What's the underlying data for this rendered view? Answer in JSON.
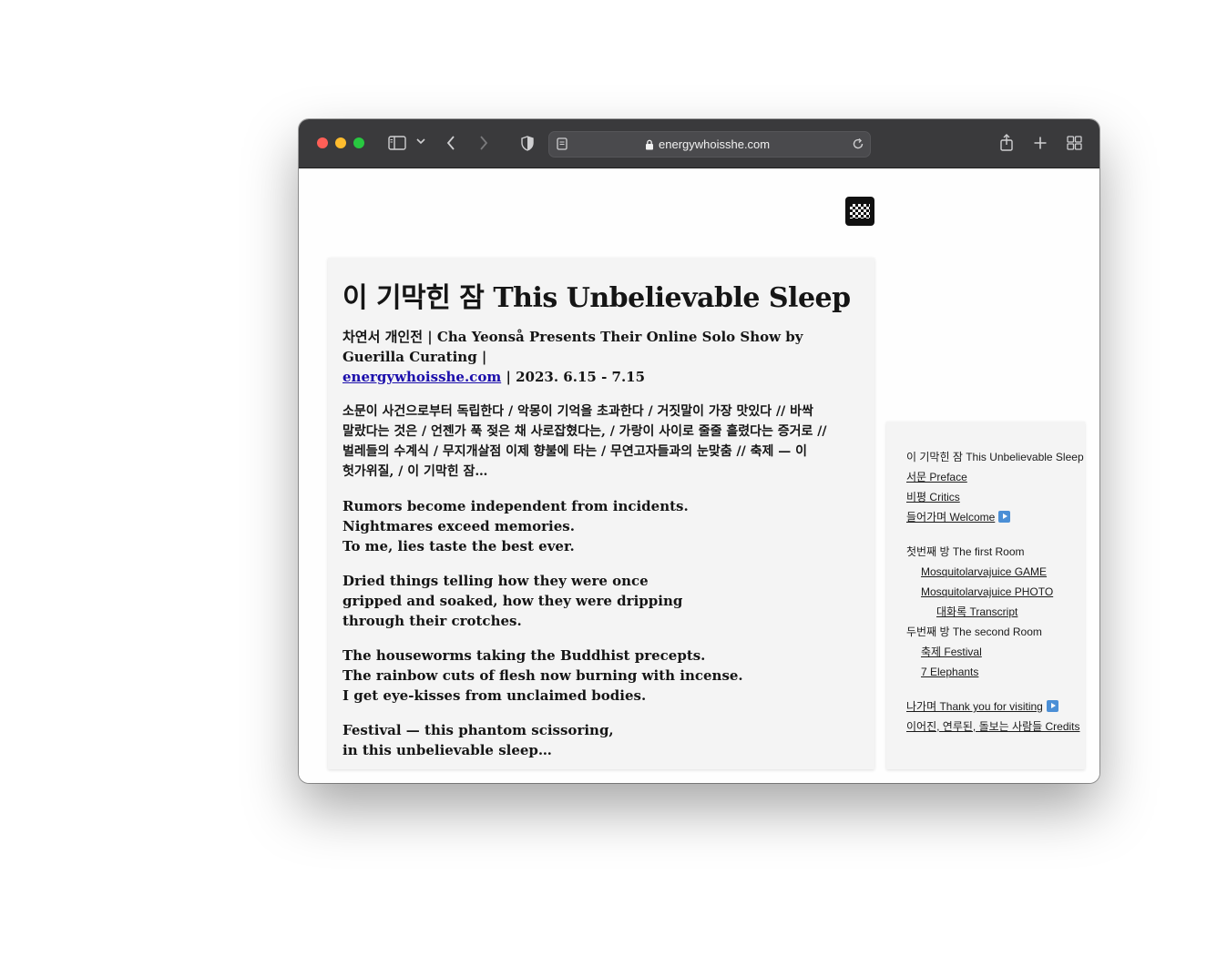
{
  "browser": {
    "url": "energywhoisshe.com"
  },
  "article": {
    "title": "이 기막힌 잠 This Unbelievable Sleep",
    "subtitle_prefix": "차연서 개인전 | Cha Yeonså Presents Their Online Solo Show by Guerilla Curating |",
    "subtitle_link": "energywhoisshe.com",
    "subtitle_suffix": "| 2023. 6.15 - 7.15",
    "korean_poem": [
      "소문이 사건으로부터 독립한다 / 악몽이 기억을 초과한다 / 거짓말이 가장 맛있다 // 바싹",
      "말랐다는 것은 / 언젠가 푹 젖은 채 사로잡혔다는, / 가랑이 사이로 줄줄 흘렸다는 증거로 //",
      "벌레들의 수계식 / 무지개살점 이제 향불에 타는 / 무연고자들과의 눈맞춤 // 축제 — 이",
      "헛가위질, / 이 기막힌 잠…"
    ],
    "stanzas": [
      [
        "Rumors become independent from incidents.",
        "Nightmares exceed memories.",
        "To me, lies taste the best ever."
      ],
      [
        "Dried things telling how they were once",
        "gripped and soaked, how they were dripping",
        "through their crotches."
      ],
      [
        "The houseworms taking the Buddhist precepts.",
        "The rainbow cuts of flesh now burning with incense.",
        "I get eye-kisses from unclaimed bodies."
      ],
      [
        "Festival — this phantom scissoring,",
        "in this unbelievable sleep…"
      ]
    ]
  },
  "nav": {
    "home": "이 기막힌 잠 This Unbelievable Sleep",
    "preface": "서문 Preface",
    "critics": "비평 Critics",
    "welcome": "들어가며 Welcome",
    "room1": "첫번째 방 The first Room",
    "mosq_game": "Mosquitolarvajuice GAME",
    "mosq_photo": "Mosquitolarvajuice PHOTO",
    "transcript": "대화록 Transcript",
    "room2": "두번째 방 The second Room",
    "festival": "축제 Festival",
    "elephants": "7 Elephants",
    "thanks": "나가며 Thank you for visiting",
    "credits": "이어진, 연루된, 돌보는 사람들 Credits"
  }
}
